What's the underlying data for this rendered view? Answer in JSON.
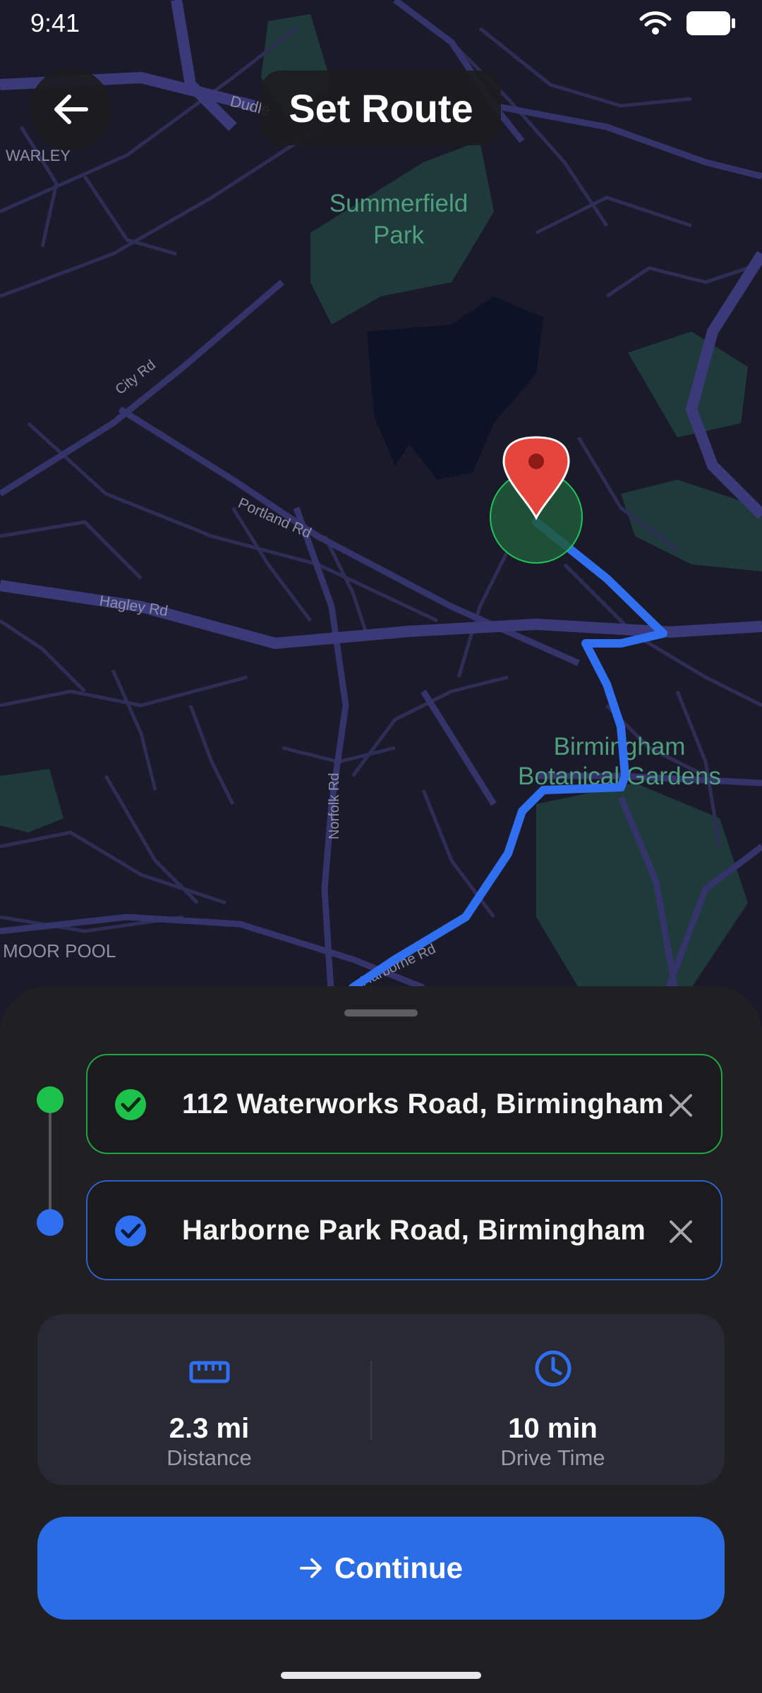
{
  "status_bar": {
    "time": "9:41"
  },
  "header": {
    "title": "Set Route"
  },
  "map": {
    "labels": {
      "warley": "WARLEY",
      "dudley": "Dudle",
      "summerfield": "Summerfield",
      "summerfield2": "Park",
      "city_rd": "City Rd",
      "portland_rd": "Portland Rd",
      "hagley_rd": "Hagley Rd",
      "botanical1": "Birmingham",
      "botanical2": "Botanical Gardens",
      "norfolk_rd": "Norfolk Rd",
      "moor_pool": "MOOR POOL",
      "harborne_rd": "Harborne Rd"
    },
    "colors": {
      "background": "#1b1a2b",
      "route": "#2f6ff0",
      "pin": "#e6453c",
      "park": "#2f6b5a"
    }
  },
  "route": {
    "start": {
      "address": "112 Waterworks Road, Birmingham",
      "icon": "check-circle-icon"
    },
    "end": {
      "address": "Harborne Park Road, Birmingham",
      "icon": "check-circle-icon"
    }
  },
  "stats": {
    "distance": {
      "value": "2.3 mi",
      "label": "Distance",
      "icon": "ruler-icon"
    },
    "drive_time": {
      "value": "10 min",
      "label": "Drive Time",
      "icon": "clock-icon"
    }
  },
  "actions": {
    "continue_label": "Continue"
  }
}
